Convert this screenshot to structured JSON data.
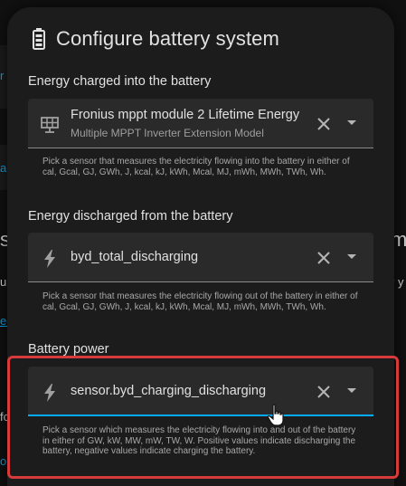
{
  "background": {
    "left_fragments": [
      "r",
      "ap",
      "s",
      "u",
      "ec",
      "fc",
      "or"
    ],
    "right_fragments": [
      "mp",
      "r y"
    ]
  },
  "dialog": {
    "title": "Configure battery system",
    "icon": "battery-icon"
  },
  "sections": [
    {
      "label": "Energy charged into the battery",
      "picker": {
        "icon": "solar-panel-icon",
        "value": "Fronius mppt module 2 Lifetime Energy",
        "secondary": "Multiple MPPT Inverter Extension Model"
      },
      "helper": "Pick a sensor that measures the electricity flowing into the battery in either of cal, Gcal, GJ, GWh, J, kcal, kJ, kWh, Mcal, MJ, mWh, MWh, TWh, Wh."
    },
    {
      "label": "Energy discharged from the battery",
      "picker": {
        "icon": "lightning-bolt-icon",
        "value": "byd_total_discharging",
        "secondary": ""
      },
      "helper": "Pick a sensor that measures the electricity flowing out of the battery in either of cal, Gcal, GJ, GWh, J, kcal, kJ, kWh, Mcal, MJ, mWh, MWh, TWh, Wh."
    },
    {
      "label": "Battery power",
      "picker": {
        "icon": "lightning-bolt-icon",
        "value": "sensor.byd_charging_discharging",
        "secondary": ""
      },
      "helper": "Pick a sensor which measures the electricity flowing into and out of the battery in either of GW, kW, MW, mW, TW, W. Positive values indicate discharging the battery, negative values indicate charging the battery."
    }
  ],
  "colors": {
    "accent": "#03a9f4",
    "highlight": "#d73a3a",
    "surface": "#1c1c1c",
    "field": "#2a2a2a"
  }
}
